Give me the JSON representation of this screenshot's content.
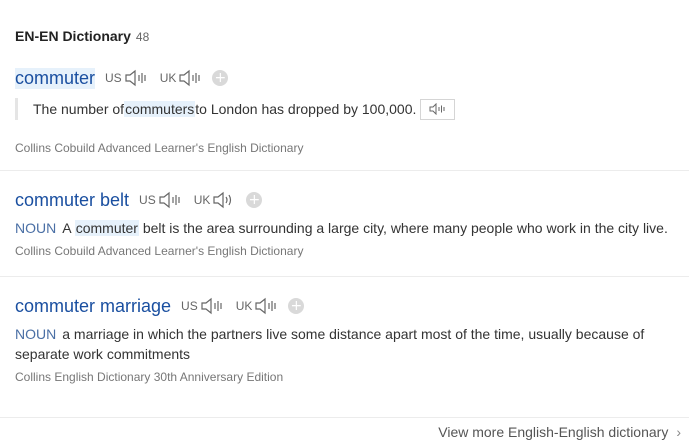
{
  "section": {
    "title": "EN-EN Dictionary",
    "count": "48"
  },
  "entries": [
    {
      "headword": "commuter",
      "us_label": "US",
      "uk_label": "UK",
      "example": {
        "before": "The number of ",
        "highlight": "commuters",
        "after": " to London has dropped by 100,000."
      },
      "source": "Collins Cobuild Advanced Learner's English Dictionary"
    },
    {
      "headword": "commuter belt",
      "us_label": "US",
      "uk_label": "UK",
      "pos": "NOUN",
      "definition": {
        "before": "A ",
        "highlight": "commuter",
        "after": " belt is the area surrounding a large city, where many people who work in the city live."
      },
      "source": "Collins Cobuild Advanced Learner's English Dictionary"
    },
    {
      "headword": "commuter marriage",
      "us_label": "US",
      "uk_label": "UK",
      "pos": "NOUN",
      "definition": {
        "text": "a marriage in which the partners live some distance apart most of the time, usually because of separate work commitments"
      },
      "source": "Collins English Dictionary 30th Anniversary Edition"
    }
  ],
  "add_symbol": "+",
  "footer": {
    "link": "View more English-English dictionary",
    "chevron": "›"
  },
  "icons": {
    "pronounce": "speaker-wave-icon",
    "add": "plus-circle-icon",
    "more": "chevron-right-icon"
  },
  "colors": {
    "headword": "#1a4fa0",
    "highlight_bg": "#e6f1fb",
    "pos": "#4a6fa5"
  }
}
